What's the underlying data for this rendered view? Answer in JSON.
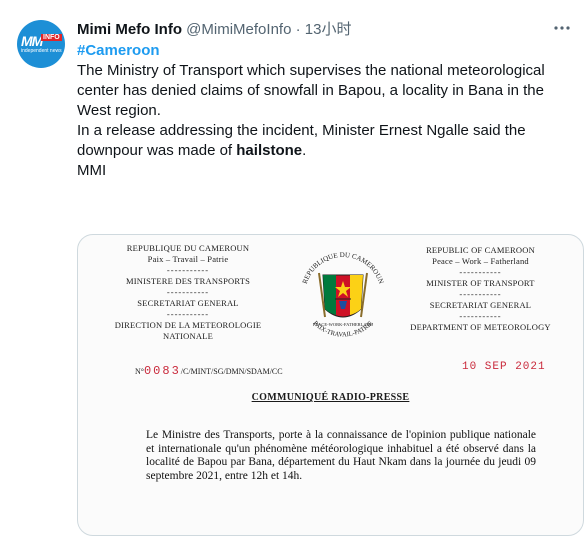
{
  "tweet": {
    "author_name": "Mimi Mefo Info",
    "handle": "@MimiMefoInfo",
    "separator": "·",
    "time": "13小时",
    "more_icon": "ellipsis-icon",
    "hashtag": "#Cameroon",
    "paragraph1": "The Ministry of Transport which supervises the national meteorological center has denied claims of snowfall in Bapou, a locality in Bana in the West region.",
    "paragraph2_pre": "In a release addressing the incident, Minister Ernest Ngalle said the downpour was made of ",
    "paragraph2_bold": "hailstone",
    "paragraph2_post": ".",
    "signature": "MMI"
  },
  "avatar": {
    "logo_mm": "MM",
    "logo_info": "INFO",
    "logo_sub": "independent news"
  },
  "document": {
    "left_header": [
      "REPUBLIQUE DU CAMEROUN",
      "Paix – Travail – Patrie",
      "-----------",
      "MINISTERE DES TRANSPORTS",
      "-----------",
      "SECRETARIAT GENERAL",
      "-----------",
      "DIRECTION DE LA METEOROLOGIE",
      "NATIONALE"
    ],
    "right_header": [
      "REPUBLIC OF CAMEROON",
      "Peace – Work – Fatherland",
      "-----------",
      "MINISTER OF TRANSPORT",
      "-----------",
      "SECRETARIAT GENERAL",
      "-----------",
      "DEPARTMENT OF METEOROLOGY"
    ],
    "emblem_top_text": "REPUBLIQUE DU CAMEROUN",
    "emblem_bottom_text": "PAIX-TRAVAIL-PATRIE",
    "emblem_motto": "PEACE-WORK-FATHERLAND",
    "ref_prefix": "N°",
    "ref_number": "0083",
    "ref_suffix": "/C/MINT/SG/DMN/SDAM/CC",
    "date": "10 SEP 2021",
    "communique_title": "COMMUNIQUÉ RADIO-PRESSE",
    "body": "Le Ministre des Transports, porte à la connaissance de l'opinion publique nationale et internationale qu'un phénomène météorologique inhabituel a été observé dans la localité de Bapou par Bana, département du Haut Nkam dans la journée du jeudi 09 septembre 2021, entre 12h et 14h."
  },
  "colors": {
    "hashtag": "#1d9bf0",
    "secondary_text": "#536471",
    "stamp_red": "#c9293b",
    "flag_green": "#007a3d",
    "flag_red": "#ce1126",
    "flag_yellow": "#fcd116"
  }
}
